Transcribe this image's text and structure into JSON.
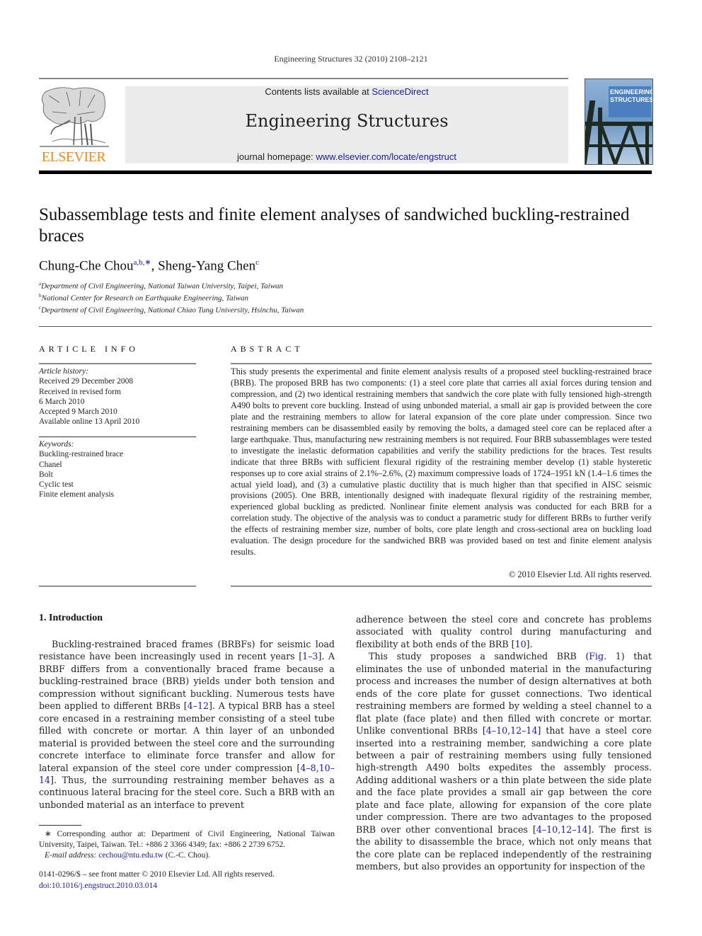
{
  "header": {
    "journal_ref": "Engineering Structures 32 (2010) 2108–2121",
    "publisher_logo_text": "ELSEVIER",
    "contents_prefix": "Contents lists available at ",
    "contents_link": "ScienceDirect",
    "journal_name": "Engineering Structures",
    "homepage_prefix": "journal homepage: ",
    "homepage_link": "www.elsevier.com/locate/engstruct",
    "cover_title_line1": "ENGINEERING",
    "cover_title_line2": "STRUCTURES"
  },
  "article": {
    "title": "Subassemblage tests and finite element analyses of sandwiched buckling-restrained braces",
    "authors": [
      {
        "name": "Chung-Che Chou",
        "marks": "a,b,∗"
      },
      {
        "name": "Sheng-Yang Chen",
        "marks": "c"
      }
    ],
    "author_separator": ", ",
    "affiliations": [
      {
        "mark": "a",
        "text": "Department of Civil Engineering, National Taiwan University, Taipei, Taiwan"
      },
      {
        "mark": "b",
        "text": "National Center for Research on Earthquake Engineering, Taiwan"
      },
      {
        "mark": "c",
        "text": "Department of Civil Engineering, National Chiao Tung University, Hsinchu, Taiwan"
      }
    ]
  },
  "article_info": {
    "heading": "ARTICLE INFO",
    "history_label": "Article history:",
    "history": [
      "Received 29 December 2008",
      "Received in revised form",
      "6 March 2010",
      "Accepted 9 March 2010",
      "Available online 13 April 2010"
    ],
    "keywords_label": "Keywords:",
    "keywords": [
      "Buckling-restrained brace",
      "Chanel",
      "Bolt",
      "Cyclic test",
      "Finite element analysis"
    ]
  },
  "abstract": {
    "heading": "ABSTRACT",
    "text": "This study presents the experimental and finite element analysis results of a proposed steel buckling-restrained brace (BRB). The proposed BRB has two components: (1) a steel core plate that carries all axial forces during tension and compression, and (2) two identical restraining members that sandwich the core plate with fully tensioned high-strength A490 bolts to prevent core buckling. Instead of using unbonded material, a small air gap is provided between the core plate and the restraining members to allow for lateral expansion of the core plate under compression. Since two restraining members can be disassembled easily by removing the bolts, a damaged steel core can be replaced after a large earthquake. Thus, manufacturing new restraining members is not required. Four BRB subassemblages were tested to investigate the inelastic deformation capabilities and verify the stability predictions for the braces. Test results indicate that three BRBs with sufficient flexural rigidity of the restraining member develop (1) stable hysteretic responses up to core axial strains of 2.1%–2.6%, (2) maximum compressive loads of 1724–1951 kN (1.4–1.6 times the actual yield load), and (3) a cumulative plastic ductility that is much higher than that specified in AISC seismic provisions (2005). One BRB, intentionally designed with inadequate flexural rigidity of the restraining member, experienced global buckling as predicted. Nonlinear finite element analysis was conducted for each BRB for a correlation study. The objective of the analysis was to conduct a parametric study for different BRBs to further verify the effects of restraining member size, number of bolts, core plate length and cross-sectional area on buckling load evaluation. The design procedure for the sandwiched BRB was provided based on test and finite element analysis results.",
    "copyright": "© 2010 Elsevier Ltd. All rights reserved."
  },
  "introduction": {
    "heading": "1.  Introduction",
    "left_p1": [
      {
        "t": "Buckling-restrained braced frames (BRBFs) for seismic load resistance have been increasingly used in recent years ["
      },
      {
        "link": "1–3"
      },
      {
        "t": "]. A BRBF differs from a conventionally braced frame because a buckling-restrained brace (BRB) yields under both tension and compression without significant buckling. Numerous tests have been applied to different BRBs ["
      },
      {
        "link": "4–12"
      },
      {
        "t": "]. A typical BRB has a steel core encased in a restraining member consisting of a steel tube filled with concrete or mortar. A thin layer of an unbonded material is provided between the steel core and the surrounding concrete interface to eliminate force transfer and allow for lateral expansion of the steel core under compression ["
      },
      {
        "link": "4–8,10–14"
      },
      {
        "t": "]. Thus, the surrounding restraining member behaves as a continuous lateral bracing for the steel core. Such a BRB with an unbonded material as an interface to prevent"
      }
    ],
    "right_p1": [
      {
        "t": "adherence between the steel core and concrete has problems associated with quality control during manufacturing and flexibility at both ends of the BRB ["
      },
      {
        "link": "10"
      },
      {
        "t": "]."
      }
    ],
    "right_p2": [
      {
        "t": "This study proposes a sandwiched BRB ("
      },
      {
        "link": "Fig. 1"
      },
      {
        "t": ") that eliminates the use of unbonded material in the manufacturing process and increases the number of design alternatives at both ends of the core plate for gusset connections. Two identical restraining members are formed by welding a steel channel to a flat plate (face plate) and then filled with concrete or mortar. Unlike conventional BRBs ["
      },
      {
        "link": "4–10,12–14"
      },
      {
        "t": "] that have a steel core inserted into a restraining member, sandwiching a core plate between a pair of restraining members using fully tensioned high-strength A490 bolts expedites the assembly process. Adding additional washers or a thin plate between the side plate and the face plate provides a small air gap between the core plate and face plate, allowing for expansion of the core plate under compression. There are two advantages to the proposed BRB over other conventional braces ["
      },
      {
        "link": "4–10,12–14"
      },
      {
        "t": "]. The first is the ability to disassemble the brace, which not only means that the core plate can be replaced independently of the restraining members, but also provides an opportunity for inspection of the"
      }
    ]
  },
  "footnote": {
    "mark": "∗",
    "text": "Corresponding author at: Department of Civil Engineering, National Taiwan University, Taipei, Taiwan. Tel.: +886 2 3366 4349; fax: +886 2 2739 6752.",
    "email_label": "E-mail address: ",
    "email": "cechou@ntu.edu.tw",
    "email_suffix": " (C.-C. Chou)."
  },
  "frontmatter": {
    "issn_line": "0141-0296/$ – see front matter © 2010 Elsevier Ltd. All rights reserved.",
    "doi": "doi:10.1016/j.engstruct.2010.03.014"
  },
  "colors": {
    "link": "#1a1aa6",
    "elsevier_orange": "#f08a1c",
    "masthead_bg": "#ebebeb",
    "cover_blue": "#4a7fc0"
  }
}
